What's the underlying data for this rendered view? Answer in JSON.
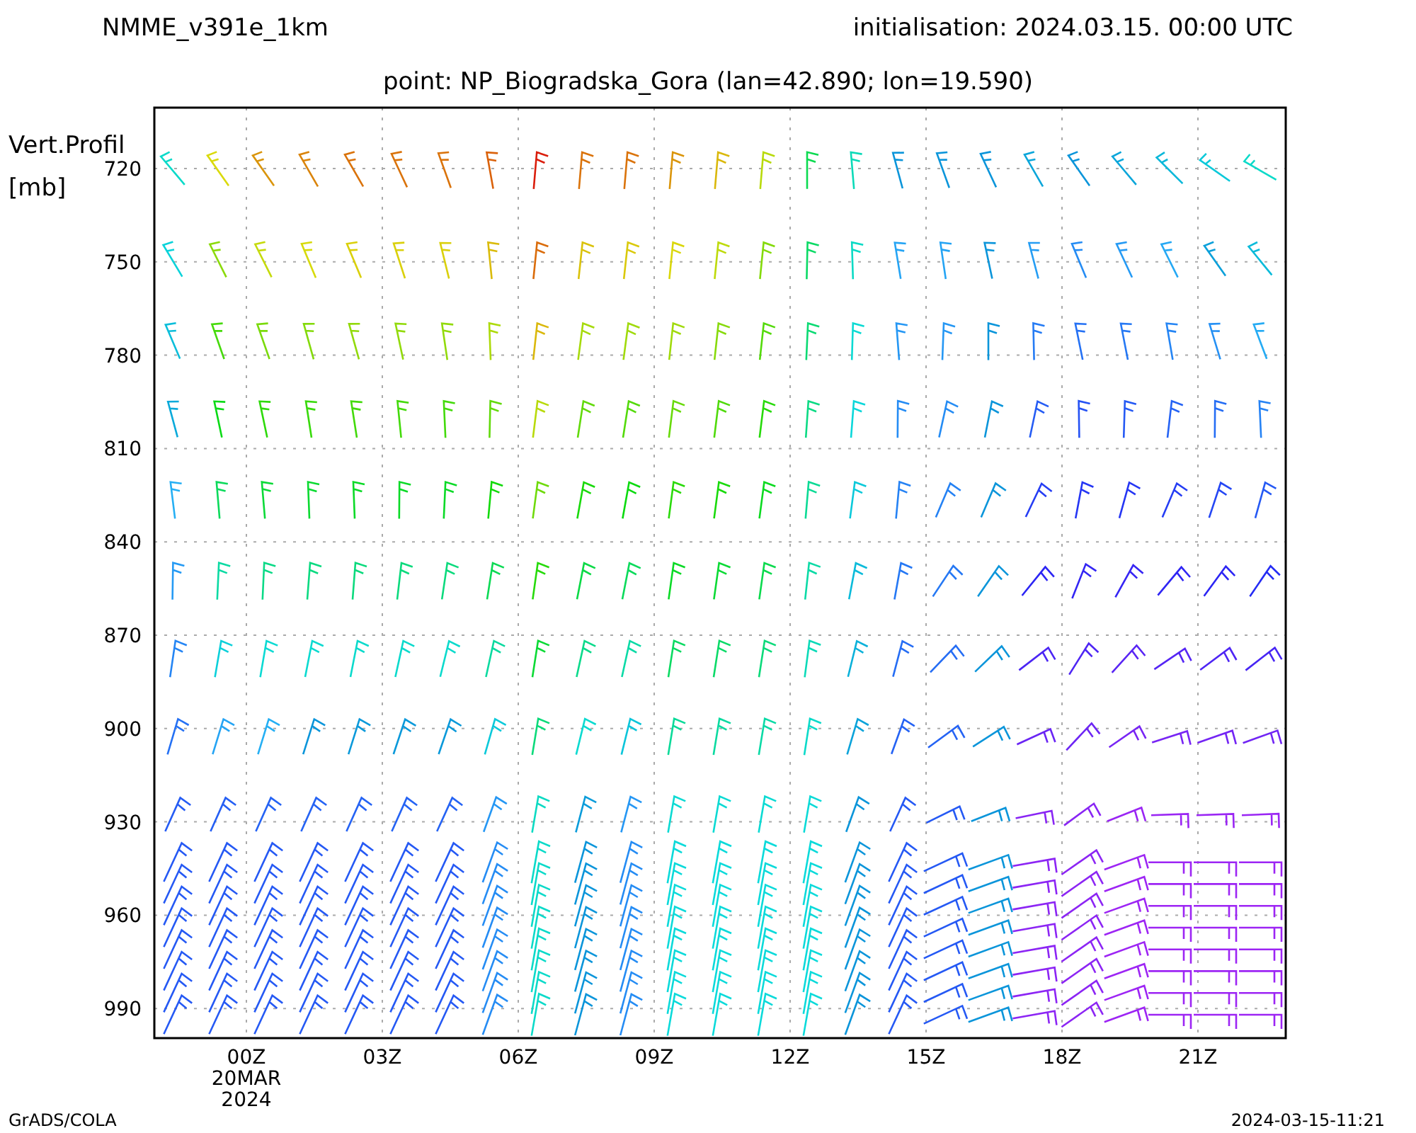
{
  "header": {
    "model": "NMME_v391e_1km",
    "initialisation": "initialisation: 2024.03.15. 00:00 UTC",
    "point": "point: NP_Biogradska_Gora (lan=42.890; lon=19.590)"
  },
  "y_axis": {
    "title": "Vert.Profil",
    "unit": "[mb]",
    "ticks": [
      "720",
      "750",
      "780",
      "810",
      "840",
      "870",
      "900",
      "930",
      "960",
      "990"
    ]
  },
  "x_axis": {
    "ticks": [
      "00Z",
      "03Z",
      "06Z",
      "09Z",
      "12Z",
      "15Z",
      "18Z",
      "21Z"
    ],
    "date_lines": [
      "20MAR",
      "2024"
    ]
  },
  "footer": {
    "left": "GrADS/COLA",
    "right": "2024-03-15-11:21"
  }
}
